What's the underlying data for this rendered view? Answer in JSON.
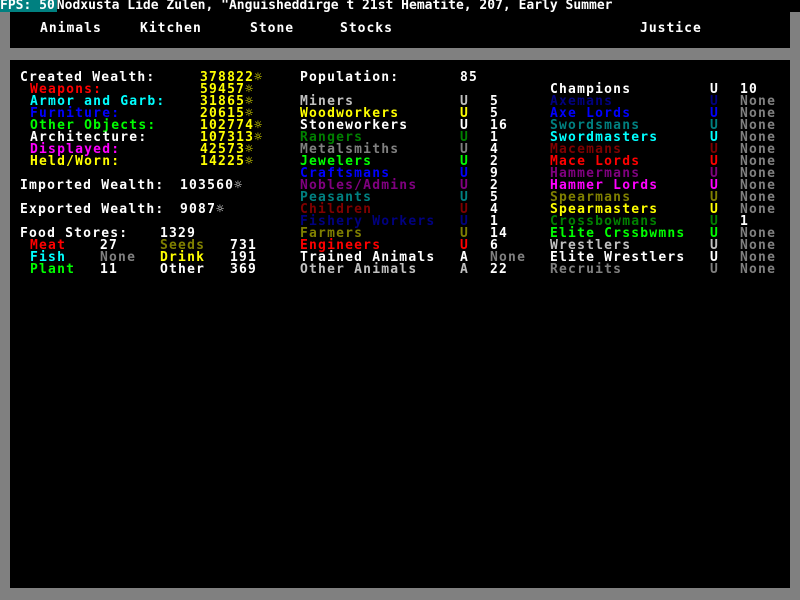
{
  "title_bar": {
    "fps": "FPS: 50",
    "text": "Nodxusta Lide Zulen, \"Anguisheddirge t 21st Hematite, 207, Early Summer"
  },
  "tabs": [
    "Animals",
    "Kitchen",
    "Stone",
    "Stocks",
    "Justice"
  ],
  "wealth": {
    "created_label": "Created Wealth:",
    "created_value": "378822☼",
    "items": [
      {
        "label": "Weapons:",
        "value": "59457☼",
        "color": "#ff0000"
      },
      {
        "label": "Armor and Garb:",
        "value": "31865☼",
        "color": "#00ffff"
      },
      {
        "label": "Furniture:",
        "value": "20615☼",
        "color": "#0000ff"
      },
      {
        "label": "Other Objects:",
        "value": "102774☼",
        "color": "#00ff00"
      },
      {
        "label": "Architecture:",
        "value": "107313☼",
        "color": "#ffffff"
      },
      {
        "label": "Displayed:",
        "value": "42573☼",
        "color": "#ff00ff"
      },
      {
        "label": "Held/Worn:",
        "value": "14225☼",
        "color": "#ffff00"
      }
    ],
    "imported_label": "Imported Wealth:",
    "imported_value": "103560☼",
    "exported_label": "Exported Wealth:",
    "exported_value": "9087☼"
  },
  "food": {
    "label": "Food Stores:",
    "total": "1329",
    "items": [
      {
        "label": "Meat",
        "value": "27"
      },
      {
        "label": "Seeds",
        "value": "731"
      },
      {
        "label": "Fish",
        "value": "None"
      },
      {
        "label": "Drink",
        "value": "191"
      },
      {
        "label": "Plant",
        "value": "11"
      },
      {
        "label": "Other",
        "value": "369"
      }
    ]
  },
  "population": {
    "label": "Population:",
    "total": "85",
    "rows": [
      {
        "label": "Miners",
        "flag": "U",
        "value": "5",
        "color": "#c0c0c0"
      },
      {
        "label": "Woodworkers",
        "flag": "U",
        "value": "5",
        "color": "#ffff00"
      },
      {
        "label": "Stoneworkers",
        "flag": "U",
        "value": "16",
        "color": "#ffffff"
      },
      {
        "label": "Rangers",
        "flag": "U",
        "value": "1",
        "color": "#008000"
      },
      {
        "label": "Metalsmiths",
        "flag": "U",
        "value": "4",
        "color": "#808080"
      },
      {
        "label": "Jewelers",
        "flag": "U",
        "value": "2",
        "color": "#00ff00"
      },
      {
        "label": "Craftsmans",
        "flag": "U",
        "value": "9",
        "color": "#0000ff"
      },
      {
        "label": "Nobles/Admins",
        "flag": "U",
        "value": "2",
        "color": "#800080"
      },
      {
        "label": "Peasants",
        "flag": "U",
        "value": "5",
        "color": "#008080"
      },
      {
        "label": "Children",
        "flag": "U",
        "value": "4",
        "color": "#800000"
      },
      {
        "label": "Fishery Workers",
        "flag": "U",
        "value": "1",
        "color": "#000080"
      },
      {
        "label": "Farmers",
        "flag": "U",
        "value": "14",
        "color": "#808000"
      },
      {
        "label": "Engineers",
        "flag": "U",
        "value": "6",
        "color": "#ff0000"
      },
      {
        "label": "Trained Animals",
        "flag": "A",
        "value": "None",
        "color": "#ffffff"
      },
      {
        "label": "Other Animals",
        "flag": "A",
        "value": "22",
        "color": "#c0c0c0"
      }
    ]
  },
  "military": {
    "rows": [
      {
        "label": "Champions",
        "flag": "U",
        "value": "10",
        "color": "#ffffff"
      },
      {
        "label": "Axemans",
        "flag": "U",
        "value": "None",
        "color": "#000080"
      },
      {
        "label": "Axe Lords",
        "flag": "U",
        "value": "None",
        "color": "#0000ff"
      },
      {
        "label": "Swordsmans",
        "flag": "U",
        "value": "None",
        "color": "#008080"
      },
      {
        "label": "Swordmasters",
        "flag": "U",
        "value": "None",
        "color": "#00ffff"
      },
      {
        "label": "Macemans",
        "flag": "U",
        "value": "None",
        "color": "#800000"
      },
      {
        "label": "Mace Lords",
        "flag": "U",
        "value": "None",
        "color": "#ff0000"
      },
      {
        "label": "Hammermans",
        "flag": "U",
        "value": "None",
        "color": "#800080"
      },
      {
        "label": "Hammer Lords",
        "flag": "U",
        "value": "None",
        "color": "#ff00ff"
      },
      {
        "label": "Spearmans",
        "flag": "U",
        "value": "None",
        "color": "#808000"
      },
      {
        "label": "Spearmasters",
        "flag": "U",
        "value": "None",
        "color": "#ffff00"
      },
      {
        "label": "Crossbowmans",
        "flag": "U",
        "value": "1",
        "color": "#008000"
      },
      {
        "label": "Elite Crssbwmns",
        "flag": "U",
        "value": "None",
        "color": "#00ff00"
      },
      {
        "label": "Wrestlers",
        "flag": "U",
        "value": "None",
        "color": "#c0c0c0"
      },
      {
        "label": "Elite Wrestlers",
        "flag": "U",
        "value": "None",
        "color": "#ffffff"
      },
      {
        "label": "Recruits",
        "flag": "U",
        "value": "None",
        "color": "#808080"
      }
    ]
  }
}
